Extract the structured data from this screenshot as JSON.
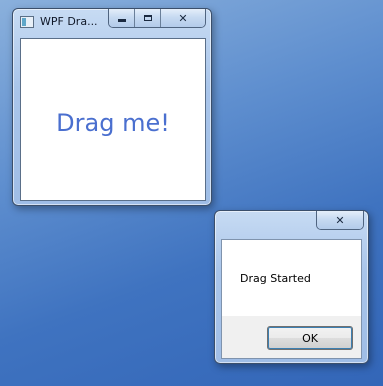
{
  "main_window": {
    "title": "WPF Dra...",
    "content_text": "Drag me!",
    "icons": {
      "app": "app-window-icon",
      "minimize": "minimize-icon",
      "maximize": "maximize-icon",
      "close": "close-icon"
    }
  },
  "message_box": {
    "message": "Drag Started",
    "ok_label": "OK",
    "icons": {
      "close": "close-icon"
    }
  }
}
